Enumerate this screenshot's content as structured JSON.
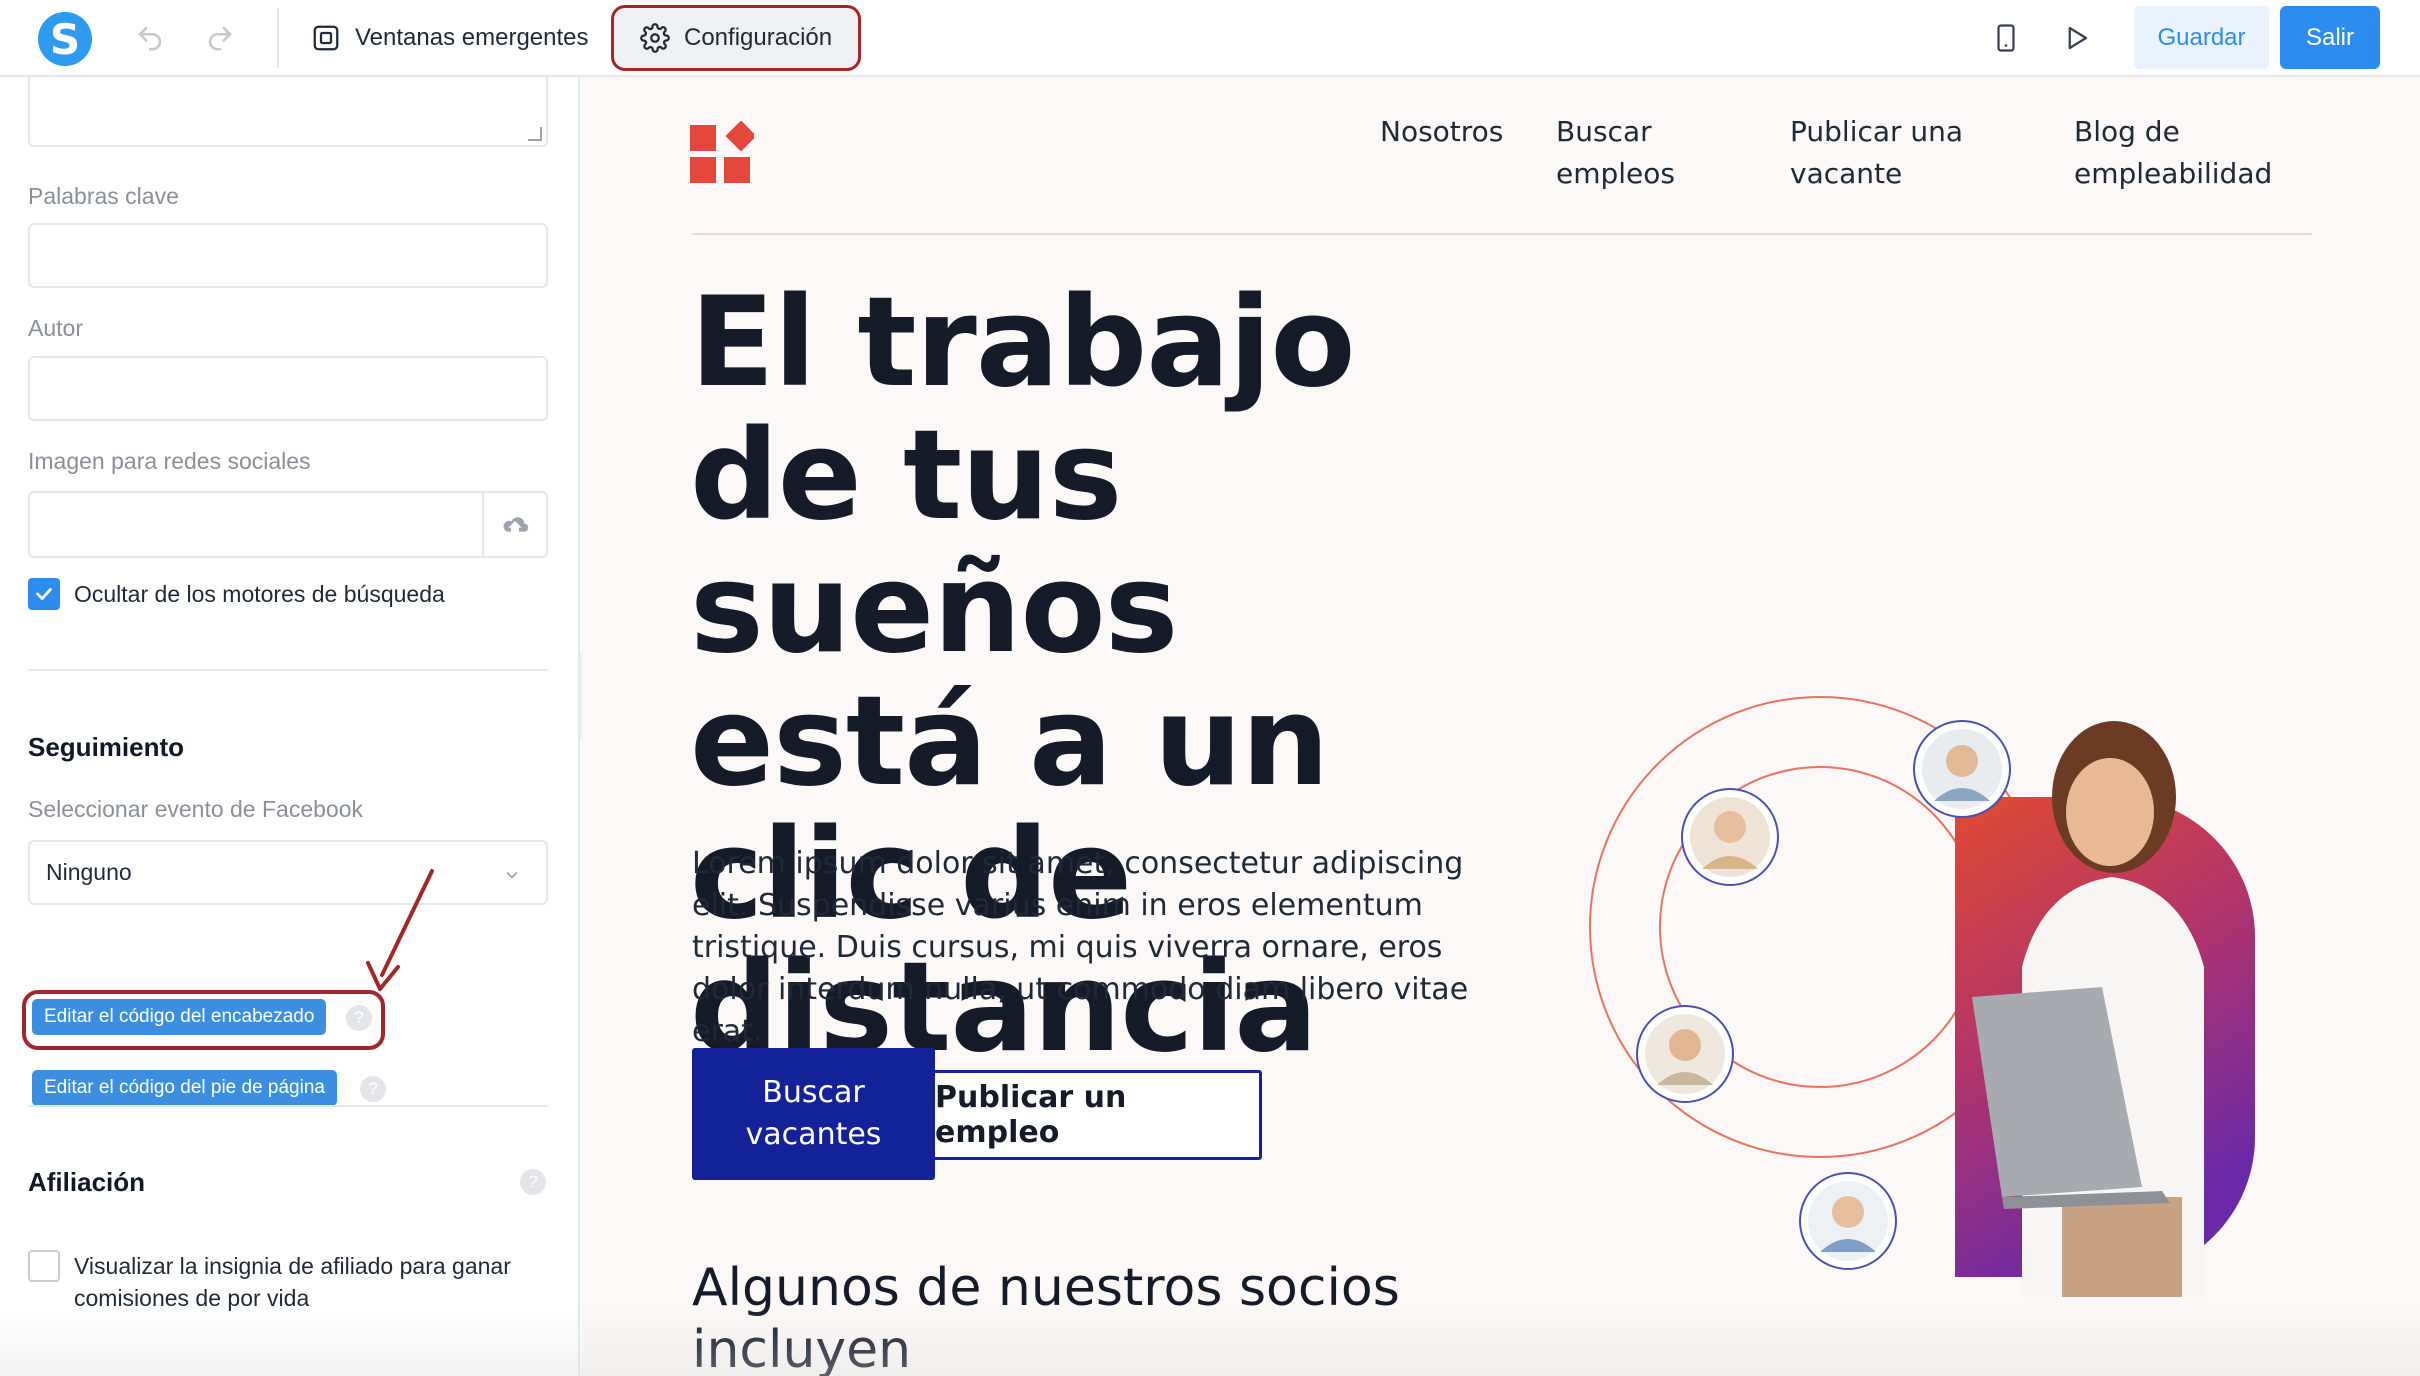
{
  "toolbar": {
    "logo_letter": "S",
    "popups_label": "Ventanas emergentes",
    "settings_label": "Configuración",
    "save_label": "Guardar",
    "exit_label": "Salir"
  },
  "settings_panel": {
    "keywords_label": "Palabras clave",
    "keywords_value": "",
    "author_label": "Autor",
    "author_value": "",
    "social_image_label": "Imagen para redes sociales",
    "hide_search_engines_label": "Ocultar de los motores de búsqueda",
    "hide_search_engines_checked": true,
    "tracking": {
      "title": "Seguimiento",
      "facebook_event_label": "Seleccionar evento de Facebook",
      "facebook_event_value": "Ninguno",
      "edit_header_code_label": "Editar el código del encabezado",
      "edit_footer_code_label": "Editar el código del pie de página"
    },
    "affiliation": {
      "title": "Afiliación",
      "affiliate_badge_label": "Visualizar la insignia de afiliado para ganar comisiones de por vida",
      "affiliate_badge_checked": false
    }
  },
  "preview": {
    "nav": {
      "about": "Nosotros",
      "find_jobs": "Buscar empleos",
      "post_job": "Publicar una vacante",
      "blog": "Blog de empleabilidad"
    },
    "hero_title": "El trabajo de tus sueños está a un clic de distancia",
    "hero_text": "Lorem ipsum dolor sit amet, consectetur adipiscing elit. Suspendisse varius enim in eros elementum tristique. Duis cursus, mi quis viverra ornare, eros dolor interdum nulla, ut commodo diam libero vitae erat.",
    "cta_primary": "Buscar vacantes",
    "cta_secondary": "Publicar un empleo",
    "partners_title": "Algunos de nuestros socios incluyen"
  },
  "colors": {
    "accent": "#2d8cf0",
    "annotation": "#a1282a",
    "brand_navy": "#14229a",
    "brand_red": "#e4483c"
  }
}
